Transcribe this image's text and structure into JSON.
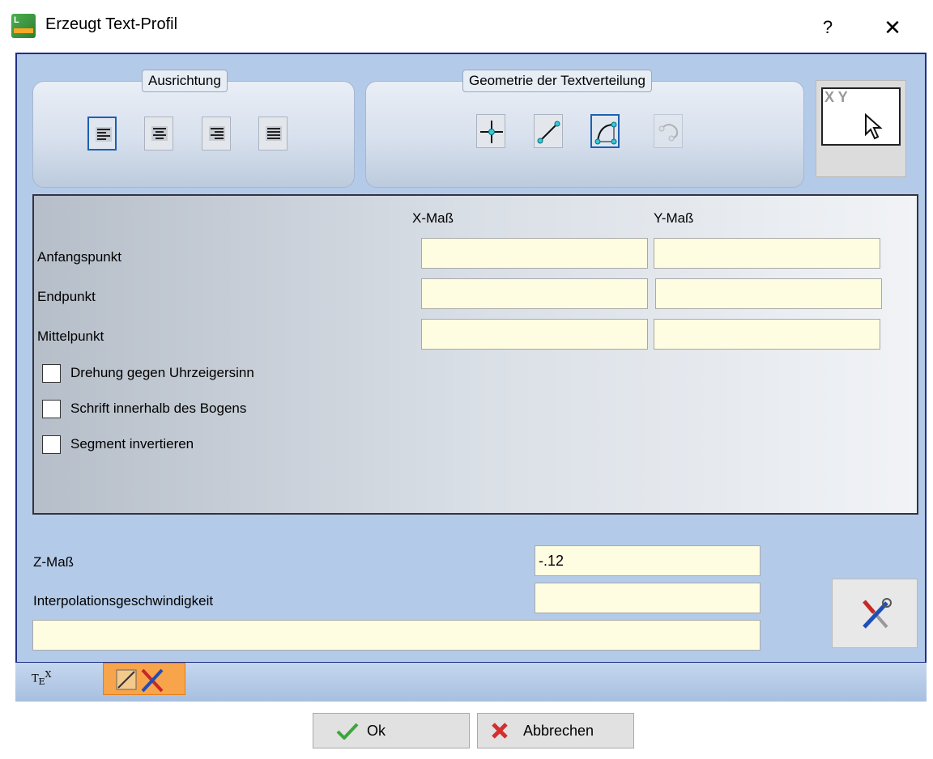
{
  "window": {
    "title": "Erzeugt Text-Profil",
    "help": "?",
    "close": "✕"
  },
  "alignment_group": {
    "label": "Ausrichtung",
    "buttons": [
      "align-left",
      "align-center",
      "align-right",
      "align-justify"
    ],
    "selected": "align-left"
  },
  "geometry_group": {
    "label": "Geometrie der Textverteilung",
    "buttons": [
      "point",
      "line",
      "arc",
      "curve"
    ],
    "selected": "arc"
  },
  "preview": {
    "overlay": "X Y"
  },
  "params": {
    "col_x": "X-Maß",
    "col_y": "Y-Maß",
    "rows": {
      "start": "Anfangspunkt",
      "end": "Endpunkt",
      "center": "Mittelpunkt"
    },
    "values": {
      "start_x": "",
      "start_y": "",
      "end_x": "",
      "end_y": "",
      "center_x": "",
      "center_y": ""
    },
    "checks": {
      "ccw": "Drehung gegen Uhrzeigersinn",
      "inside_arc": "Schrift innerhalb des Bogens",
      "invert_segment": "Segment invertieren"
    },
    "checked": {
      "ccw": false,
      "inside_arc": false,
      "invert_segment": false
    }
  },
  "bottom": {
    "z_label": "Z-Maß",
    "z_value": "-.12",
    "speed_label": "Interpolationsgeschwindigkeit",
    "speed_value": "",
    "text_value": ""
  },
  "tabs": {
    "tab1": "TEX",
    "tab2_active": true
  },
  "buttons": {
    "ok": "Ok",
    "cancel": "Abbrechen"
  },
  "colors": {
    "frame_border": "#1f2f88",
    "panel_bg": "#b3cbe8",
    "field_bg": "#fffde1",
    "active_tab": "#f7a44a"
  }
}
